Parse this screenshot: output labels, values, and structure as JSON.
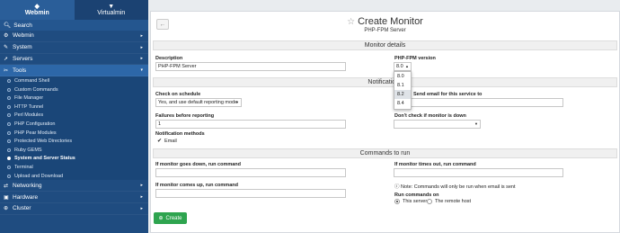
{
  "sidebar": {
    "tabs": [
      {
        "label": "Webmin",
        "icon": "webmin-logo-icon"
      },
      {
        "label": "Virtualmin",
        "icon": "virtualmin-logo-icon"
      }
    ],
    "search_label": "Search",
    "categories_top": [
      {
        "label": "Webmin"
      },
      {
        "label": "System"
      },
      {
        "label": "Servers"
      },
      {
        "label": "Tools"
      }
    ],
    "tools_items": [
      "Command Shell",
      "Custom Commands",
      "File Manager",
      "HTTP Tunnel",
      "Perl Modules",
      "PHP Configuration",
      "PHP Pear Modules",
      "Protected Web Directories",
      "Ruby GEMS",
      "System and Server Status",
      "Terminal",
      "Upload and Download"
    ],
    "active_item": "System and Server Status",
    "categories_bottom": [
      {
        "label": "Networking"
      },
      {
        "label": "Hardware"
      },
      {
        "label": "Cluster"
      }
    ]
  },
  "page": {
    "title": "Create Monitor",
    "subtitle": "PHP-FPM Server",
    "section_details": "Monitor details",
    "section_notifications": "Notifications",
    "section_commands": "Commands to run",
    "description_label": "Description",
    "description_value": "PHP-FPM Server",
    "php_version_label": "PHP-FPM version",
    "php_version_value": "8.0",
    "php_versions": [
      "8.0",
      "8.1",
      "8.2",
      "8.4"
    ],
    "check_schedule_label": "Check on schedule",
    "check_schedule_value": "Yes, and use default reporting mode",
    "send_email_label": "Send email for this service to",
    "failures_label": "Failures before reporting",
    "failures_value": "1",
    "dont_check_label": "Don't check if monitor is down",
    "notif_methods_label": "Notification methods",
    "notif_email_label": "Email",
    "cmd_down_label": "If monitor goes down, run command",
    "cmd_timeout_label": "If monitor times out, run command",
    "cmd_up_label": "If monitor comes up, run command",
    "note_text": "Note: Commands will only be run when email is sent",
    "run_on_label": "Run commands on",
    "run_on_options": [
      "This server",
      "The remote host"
    ],
    "create_label": "Create"
  },
  "colors": {
    "sidebar_bg": "#1f4c80",
    "create_button": "#2ea44f"
  }
}
